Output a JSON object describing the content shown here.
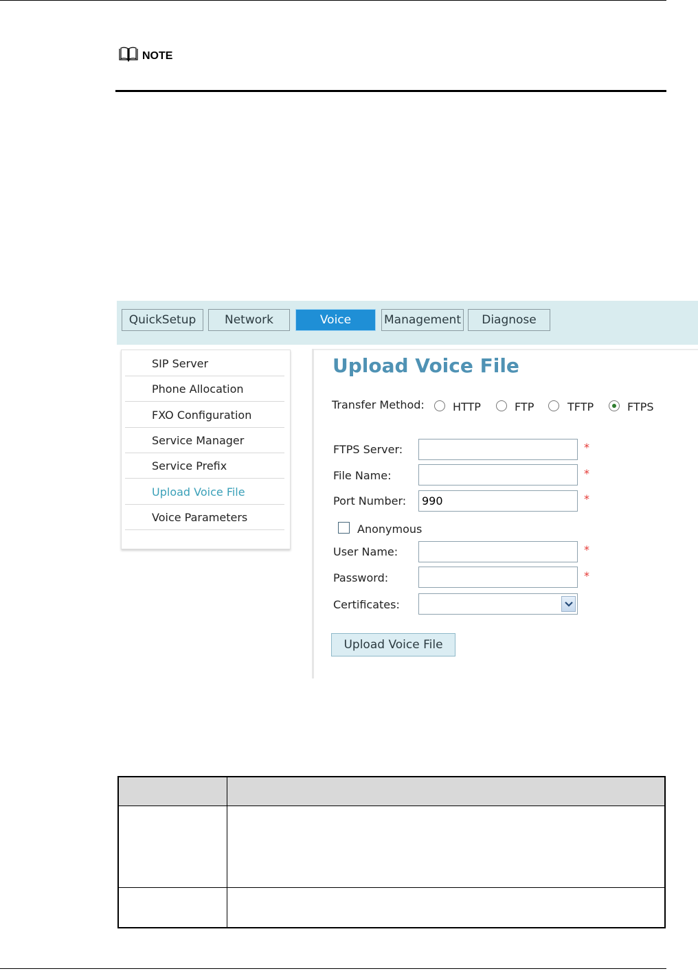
{
  "note": {
    "label": "NOTE"
  },
  "screenshot": {
    "tabs": [
      {
        "label": "QuickSetup",
        "active": false
      },
      {
        "label": "Network",
        "active": false
      },
      {
        "label": "Voice",
        "active": true
      },
      {
        "label": "Management",
        "active": false
      },
      {
        "label": "Diagnose",
        "active": false
      }
    ],
    "sidebar": {
      "items": [
        {
          "label": "SIP Server",
          "active": false
        },
        {
          "label": "Phone Allocation",
          "active": false
        },
        {
          "label": "FXO Configuration",
          "active": false
        },
        {
          "label": "Service Manager",
          "active": false
        },
        {
          "label": "Service Prefix",
          "active": false
        },
        {
          "label": "Upload Voice File",
          "active": true
        },
        {
          "label": "Voice Parameters",
          "active": false
        }
      ]
    },
    "form": {
      "title": "Upload Voice File",
      "transfer_method_label": "Transfer Method:",
      "methods": [
        {
          "label": "HTTP",
          "checked": false
        },
        {
          "label": "FTP",
          "checked": false
        },
        {
          "label": "TFTP",
          "checked": false
        },
        {
          "label": "FTPS",
          "checked": true
        }
      ],
      "required_mark": "*",
      "ftps_server": {
        "label": "FTPS Server:",
        "value": ""
      },
      "file_name": {
        "label": "File Name:",
        "value": ""
      },
      "port_number": {
        "label": "Port Number:",
        "value": "990"
      },
      "anonymous": {
        "label": "Anonymous",
        "checked": false
      },
      "user_name": {
        "label": "User Name:",
        "value": ""
      },
      "password": {
        "label": "Password:",
        "value": ""
      },
      "certificates": {
        "label": "Certificates:",
        "value": ""
      },
      "upload_button": "Upload Voice File"
    }
  },
  "colors": {
    "accent_blue": "#1f8fd6",
    "title_blue": "#4f92b4",
    "active_nav": "#3aa0b8",
    "required_red": "#e53935",
    "topbar_bg": "#d9ecef"
  }
}
